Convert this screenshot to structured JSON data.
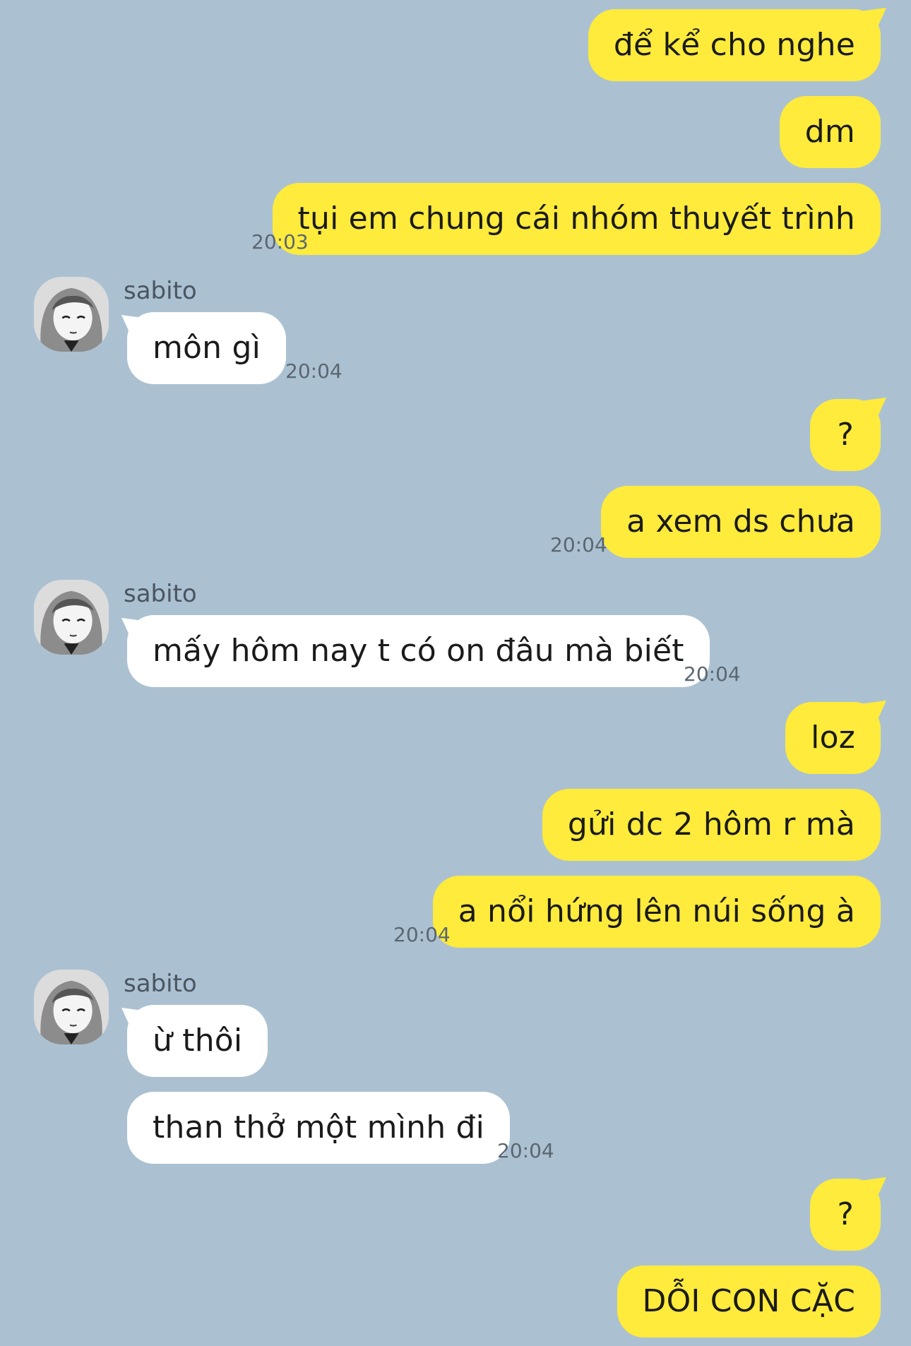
{
  "contact": {
    "name": "sabito"
  },
  "messages": {
    "m1": {
      "text": "để kể cho nghe"
    },
    "m2": {
      "text": "dm"
    },
    "m3": {
      "text": "tụi em chung cái nhóm thuyết trình",
      "time": "20:03"
    },
    "m4": {
      "text": "môn gì",
      "time": "20:04"
    },
    "m5": {
      "text": "?"
    },
    "m6": {
      "text": "a xem ds chưa",
      "time": "20:04"
    },
    "m7": {
      "text": "mấy hôm nay t có on đâu mà biết",
      "time": "20:04"
    },
    "m8": {
      "text": "loz"
    },
    "m9": {
      "text": "gửi dc 2 hôm r mà"
    },
    "m10": {
      "text": "a nổi hứng lên núi sống à",
      "time": "20:04"
    },
    "m11": {
      "text": "ừ thôi"
    },
    "m12": {
      "text": "than thở một mình đi",
      "time": "20:04"
    },
    "m13": {
      "text": "?"
    },
    "m14": {
      "text": "DỖI CON CẶC"
    }
  },
  "colors": {
    "background": "#abc1d2",
    "outgoing_bubble": "#ffeb3b",
    "incoming_bubble": "#ffffff"
  },
  "icons": {
    "avatar": "anime-girl-avatar"
  }
}
